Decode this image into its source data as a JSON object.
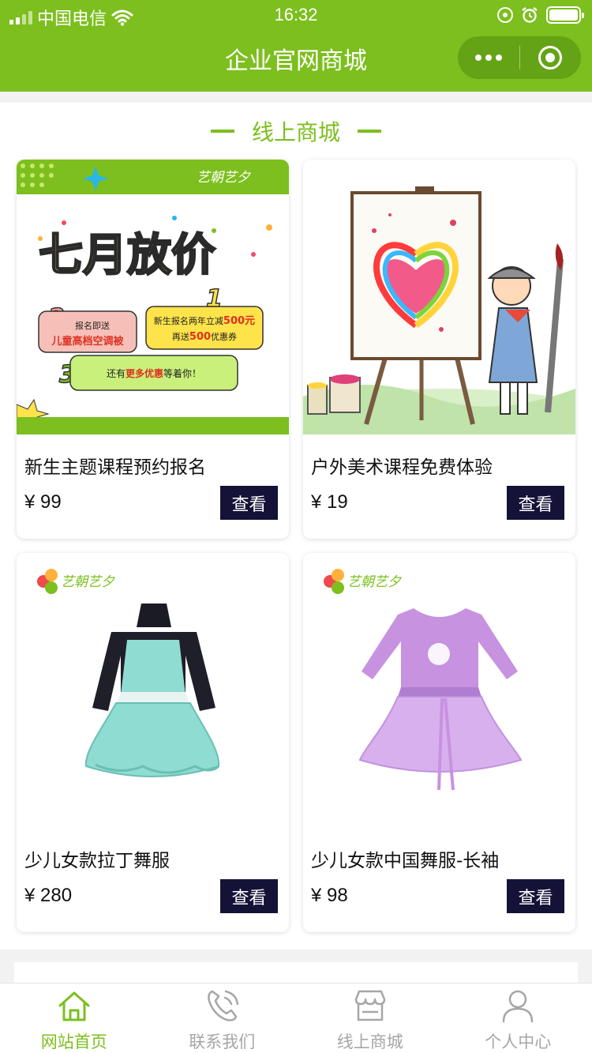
{
  "status_bar": {
    "carrier": "中国电信",
    "time": "16:32"
  },
  "nav": {
    "title": "企业官网商城"
  },
  "section": {
    "title": "线上商城"
  },
  "theme": {
    "accent": "#7cbf1e",
    "button_bg": "#141236"
  },
  "products": [
    {
      "name": "新生主题课程预约报名",
      "price": "¥ 99",
      "button": "查看",
      "image_text": {
        "brand": "艺朝艺夕",
        "headline": "七月放价",
        "n1": "1",
        "p1a": "新生报名两年立减",
        "p1b": "500元",
        "p1c": "再送",
        "p1d": "500",
        "p1e": "优惠券",
        "n2": "2",
        "p2a": "报名即送",
        "p2b": "儿童高档空调被",
        "n3": "3",
        "p3a": "还有",
        "p3b": "更多优惠",
        "p3c": "等着你！"
      }
    },
    {
      "name": "户外美术课程免费体验",
      "price": "¥ 19",
      "button": "查看"
    },
    {
      "name": "少儿女款拉丁舞服",
      "price": "¥ 280",
      "button": "查看",
      "image_text": {
        "brand": "艺朝艺夕"
      }
    },
    {
      "name": "少儿女款中国舞服-长袖",
      "price": "¥ 98",
      "button": "查看",
      "image_text": {
        "brand": "艺朝艺夕"
      }
    }
  ],
  "tabbar": [
    {
      "label": "网站首页",
      "icon": "home-icon",
      "active": true
    },
    {
      "label": "联系我们",
      "icon": "phone-icon",
      "active": false
    },
    {
      "label": "线上商城",
      "icon": "store-icon",
      "active": false
    },
    {
      "label": "个人中心",
      "icon": "user-icon",
      "active": false
    }
  ]
}
